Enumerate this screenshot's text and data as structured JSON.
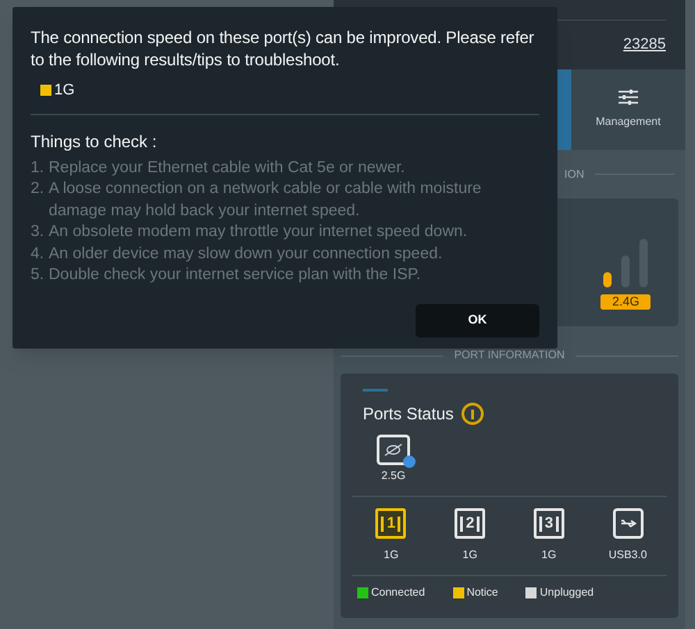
{
  "background": {
    "account_link": "23285",
    "tabs": [
      {
        "label": "Management",
        "selected": false
      }
    ],
    "section_fragment": "ION",
    "band_badge": "2.4G",
    "port_section_title": "PORT INFORMATION",
    "ports_card": {
      "title": "Ports Status",
      "wan_port": {
        "speed": "2.5G"
      },
      "lan_ports": [
        {
          "kind": "lan",
          "number": "1",
          "speed": "1G",
          "notice": true
        },
        {
          "kind": "lan",
          "number": "2",
          "speed": "1G",
          "notice": false
        },
        {
          "kind": "lan",
          "number": "3",
          "speed": "1G",
          "notice": false
        },
        {
          "kind": "usb",
          "speed": "USB3.0",
          "notice": false
        }
      ],
      "legend": [
        {
          "label": "Connected",
          "color": "#22c414"
        },
        {
          "label": "Notice",
          "color": "#f0c000"
        },
        {
          "label": "Unplugged",
          "color": "#d8d8d8"
        }
      ]
    }
  },
  "dialog": {
    "message": "The connection speed on these port(s) can be improved. Please refer to the following results/tips to troubleshoot.",
    "affected": [
      {
        "label": "1G",
        "color": "#f0c000"
      }
    ],
    "checklist_title": "Things to check :",
    "tips": [
      "Replace your Ethernet cable with Cat 5e or newer.",
      "A loose connection on a network cable or cable with moisture damage may hold back your internet speed.",
      "An obsolete modem may throttle your internet speed down.",
      "An older device may slow down your connection speed.",
      "Double check your internet service plan with the ISP."
    ],
    "tip_numbers": [
      "1.",
      "2.",
      "3.",
      "4.",
      "5."
    ],
    "ok_button": "OK"
  }
}
